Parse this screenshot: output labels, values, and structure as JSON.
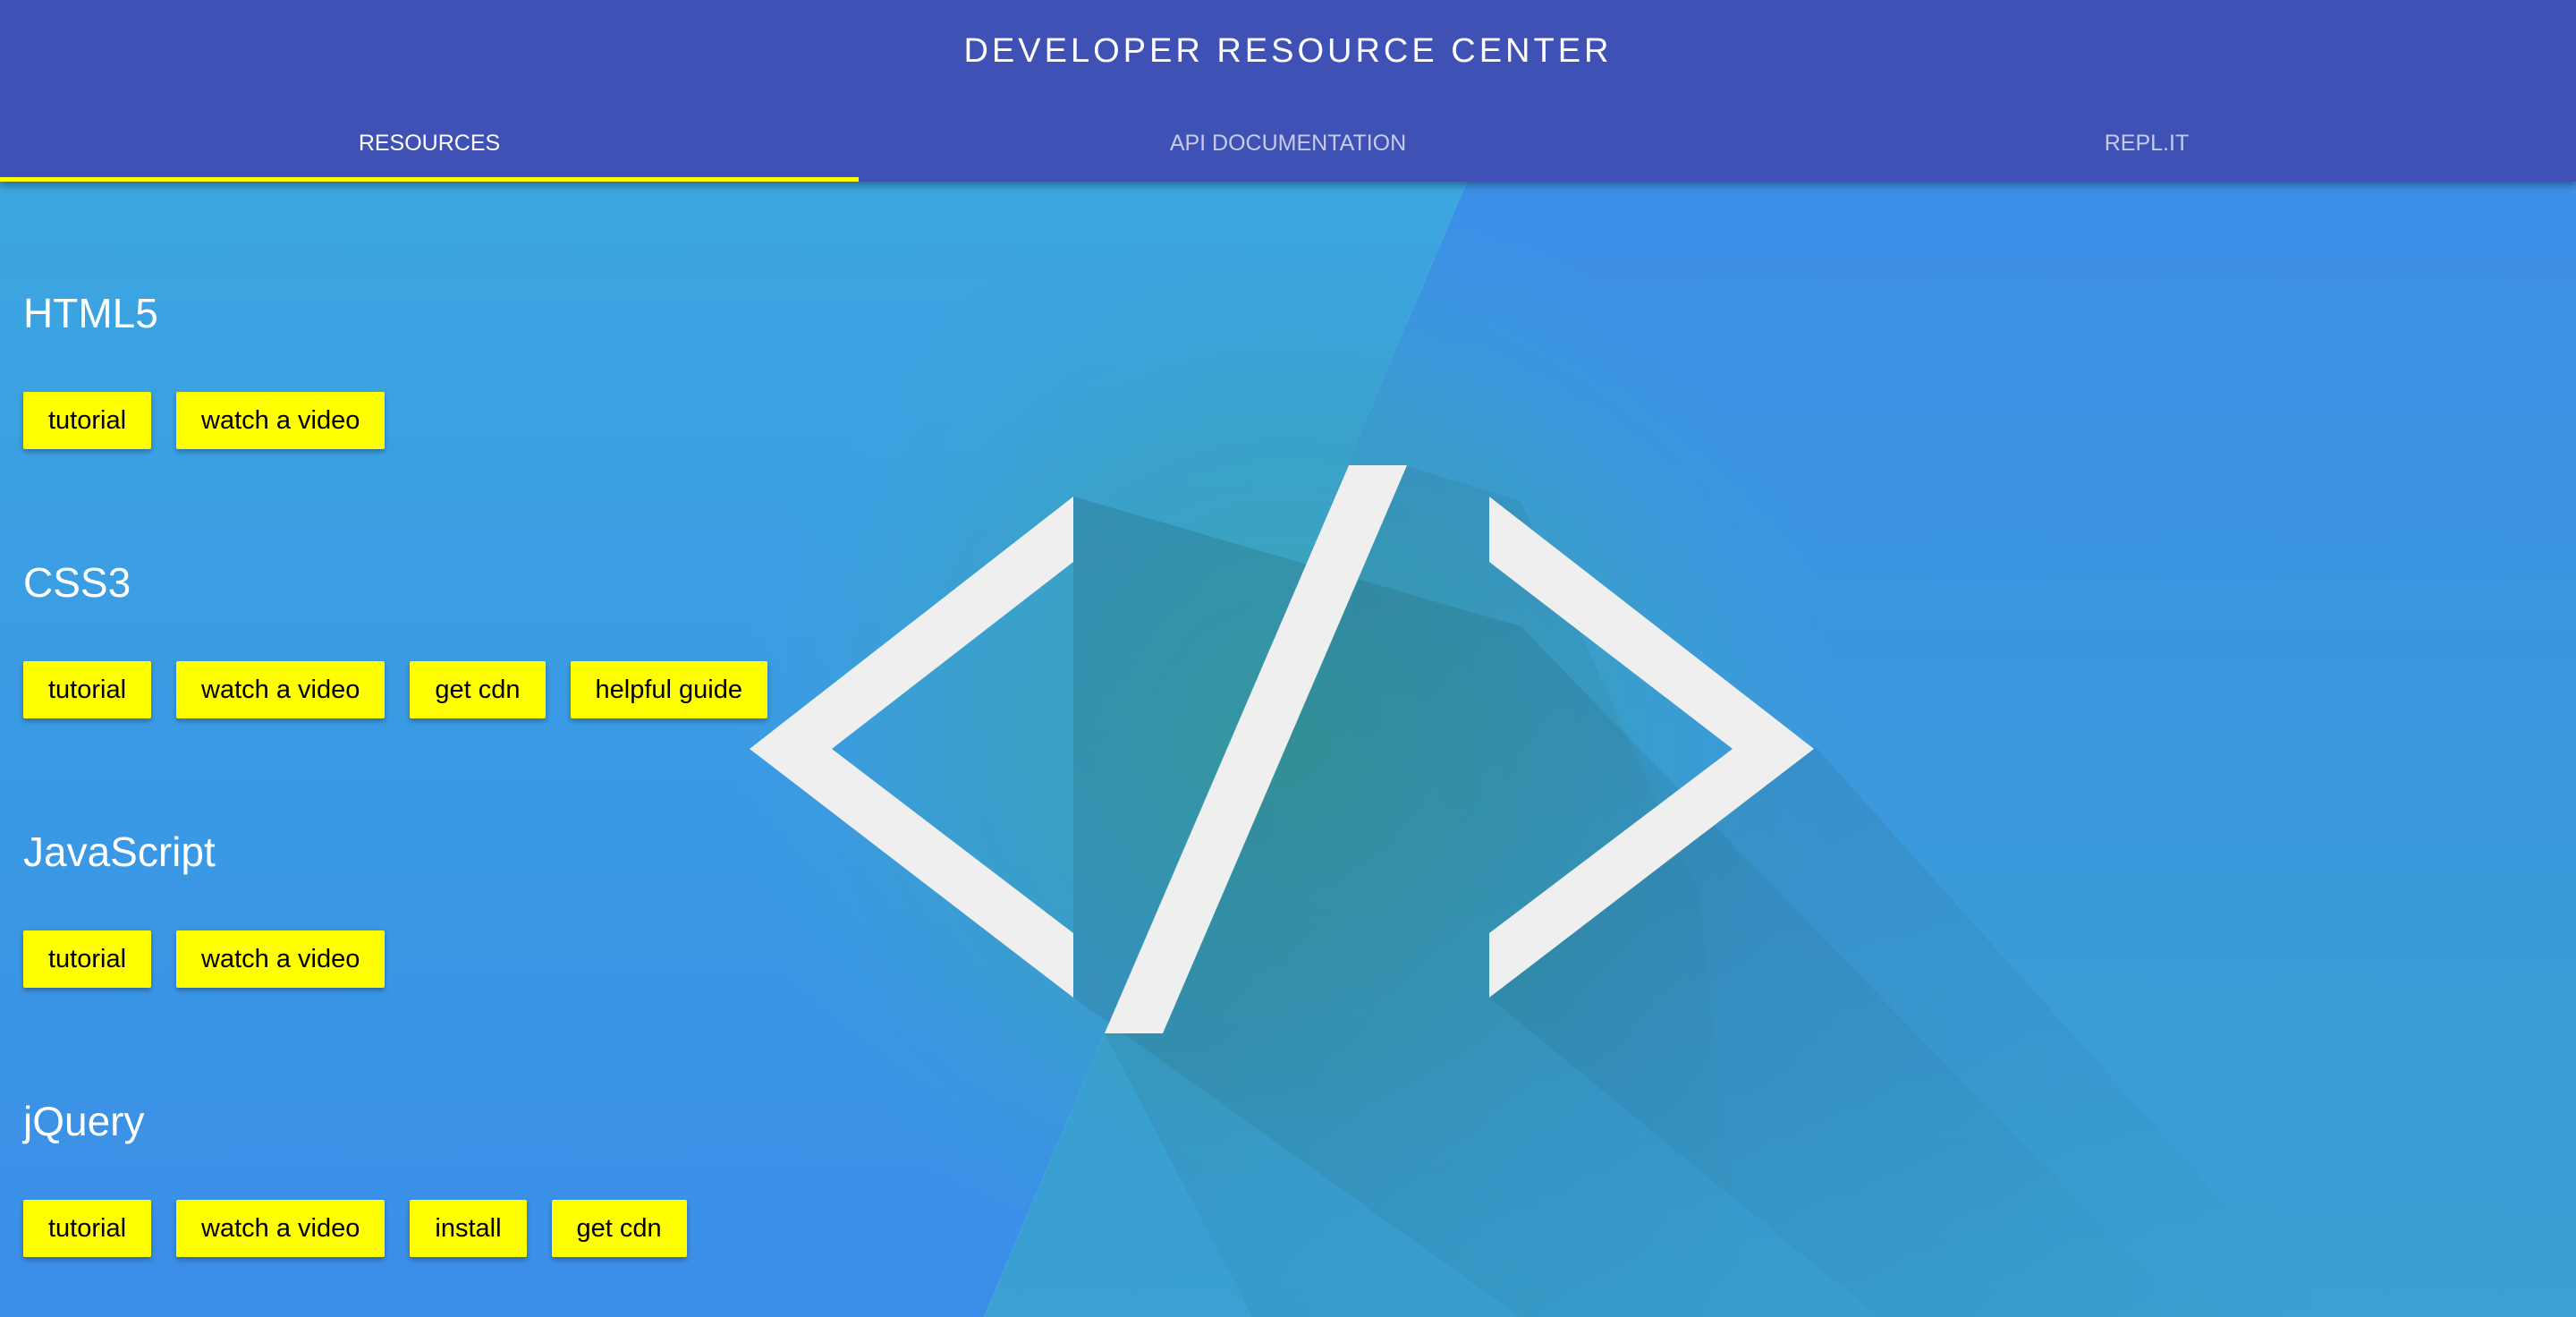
{
  "header": {
    "title": "DEVELOPER RESOURCE CENTER"
  },
  "tabs": [
    {
      "label": "RESOURCES",
      "active": true
    },
    {
      "label": "API DOCUMENTATION",
      "active": false
    },
    {
      "label": "REPL.IT",
      "active": false
    }
  ],
  "sections": [
    {
      "title": "HTML5",
      "buttons": [
        "tutorial",
        "watch a video"
      ]
    },
    {
      "title": "CSS3",
      "buttons": [
        "tutorial",
        "watch a video",
        "get cdn",
        "helpful guide"
      ]
    },
    {
      "title": "JavaScript",
      "buttons": [
        "tutorial",
        "watch a video"
      ]
    },
    {
      "title": "jQuery",
      "buttons": [
        "tutorial",
        "watch a video",
        "install",
        "get cdn"
      ]
    }
  ],
  "colors": {
    "header": "#3f51b5",
    "tab_indicator": "#ffff00",
    "button": "#ffff00",
    "background_light": "#3aa3e6",
    "background_dark": "#2f7a84",
    "logo": "#efefef"
  },
  "hero": {
    "logo_icon": "code-brackets-icon"
  }
}
